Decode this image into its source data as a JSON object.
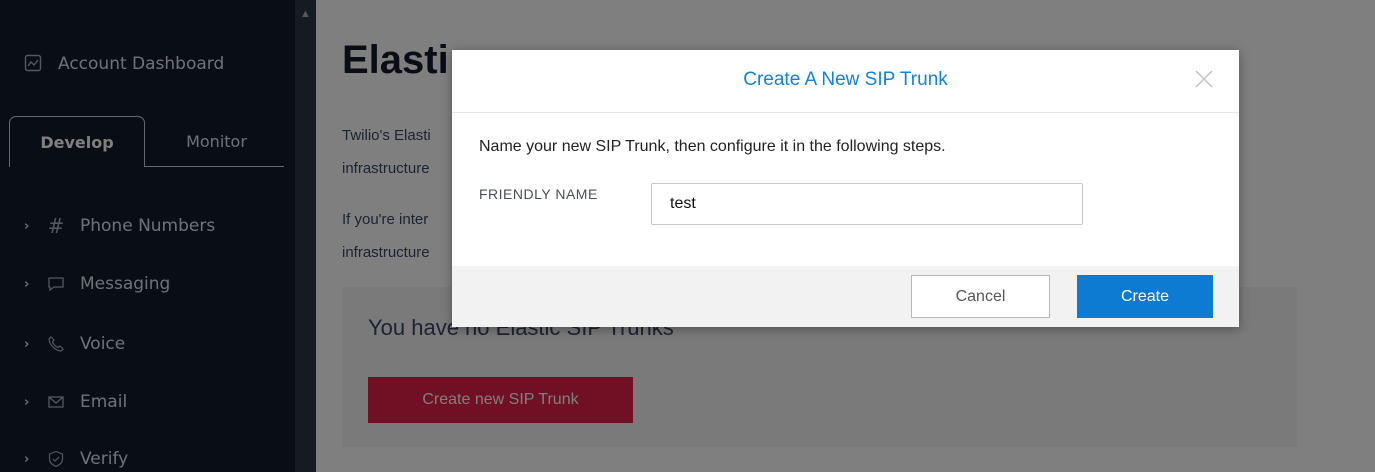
{
  "sidebar": {
    "dashboard_label": "Account Dashboard",
    "tabs": [
      {
        "label": "Develop",
        "active": true
      },
      {
        "label": "Monitor",
        "active": false
      }
    ],
    "items": [
      {
        "label": "Phone Numbers",
        "icon": "hash-icon"
      },
      {
        "label": "Messaging",
        "icon": "chat-bubble-icon"
      },
      {
        "label": "Voice",
        "icon": "phone-icon"
      },
      {
        "label": "Email",
        "icon": "envelope-icon"
      },
      {
        "label": "Verify",
        "icon": "shield-check-icon"
      }
    ]
  },
  "main": {
    "title": "Elasti",
    "intro_lines": [
      "Twilio's Elasti",
      "infrastructure",
      "If you're inter",
      "infrastructure"
    ],
    "empty_text": "You have no Elastic SIP Trunks",
    "create_button": "Create new SIP Trunk"
  },
  "modal": {
    "title": "Create A New SIP Trunk",
    "description": "Name your new SIP Trunk, then configure it in the following steps.",
    "field_label": "FRIENDLY NAME",
    "field_value": "test",
    "cancel_label": "Cancel",
    "create_label": "Create"
  },
  "colors": {
    "sidebar_bg": "#121c2d",
    "accent_blue": "#1282de",
    "primary_button": "#0d7bd1",
    "danger_red": "#e31e4a"
  }
}
